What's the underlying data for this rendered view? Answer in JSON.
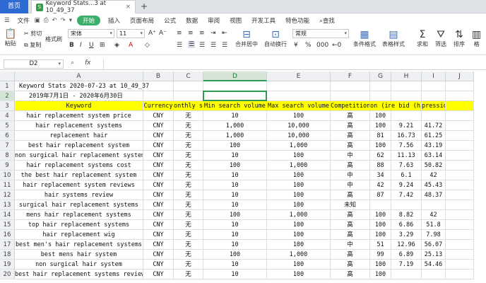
{
  "tabs": {
    "home": "首页",
    "doc": "Keyword Stats...3 at 10_49_37",
    "doc_close": "×",
    "add": "+",
    "file_icon": "S"
  },
  "menu": {
    "file": "文件",
    "items": [
      "开始",
      "插入",
      "页面布局",
      "公式",
      "数据",
      "审阅",
      "视图",
      "开发工具",
      "特色功能"
    ],
    "search": "查找"
  },
  "ribbon": {
    "paste": "粘贴",
    "cut": "剪切",
    "copy": "复制",
    "format_painter": "格式刷",
    "font_name": "宋体",
    "font_size": "11",
    "merge_center": "合并居中",
    "wrap": "自动换行",
    "number_format": "常规",
    "conditional": "条件格式",
    "table_style": "表格样式",
    "sum": "求和",
    "filter": "筛选",
    "sort": "排序",
    "more": "格"
  },
  "formula_bar": {
    "name_box": "D2",
    "fx": "fx",
    "value": ""
  },
  "grid": {
    "columns": [
      "A",
      "B",
      "C",
      "D",
      "E",
      "F",
      "G",
      "H",
      "I",
      "J"
    ],
    "selected_column": "D",
    "selected_row": "2",
    "row_numbers": [
      "1",
      "2",
      "3",
      "4",
      "5",
      "6",
      "7",
      "8",
      "9",
      "10",
      "11",
      "12",
      "13",
      "14",
      "15",
      "16",
      "17",
      "18",
      "19",
      "20"
    ],
    "rows": [
      [
        "Keyword Stats 2020-07-23 at 10_49_37",
        "",
        "",
        "",
        "",
        "",
        "",
        "",
        "",
        ""
      ],
      [
        "2019年7月1日 - 2020年6月30日",
        "",
        "",
        "",
        "",
        "",
        "",
        "",
        "",
        ""
      ],
      [
        "Keyword",
        "Currency",
        "onthly se",
        "Min search volume",
        "Max search volume",
        "Competition",
        "on (indexge bid (lo",
        "e bid (hi",
        "pression",
        ""
      ],
      [
        "hair replacement system price",
        "CNY",
        "无",
        "10",
        "100",
        "高",
        "100",
        "",
        "",
        ""
      ],
      [
        "hair replacement systems",
        "CNY",
        "无",
        "1,000",
        "10,000",
        "高",
        "100",
        "9.21",
        "41.72",
        ""
      ],
      [
        "replacement hair",
        "CNY",
        "无",
        "1,000",
        "10,000",
        "高",
        "81",
        "16.73",
        "61.25",
        ""
      ],
      [
        "best hair replacement system",
        "CNY",
        "无",
        "100",
        "1,000",
        "高",
        "100",
        "7.56",
        "43.19",
        ""
      ],
      [
        "non surgical hair replacement systems",
        "CNY",
        "无",
        "10",
        "100",
        "中",
        "62",
        "11.13",
        "63.14",
        ""
      ],
      [
        "hair replacement systems cost",
        "CNY",
        "无",
        "100",
        "1,000",
        "高",
        "88",
        "7.63",
        "50.82",
        ""
      ],
      [
        "the best hair replacement system",
        "CNY",
        "无",
        "10",
        "100",
        "中",
        "34",
        "6.1",
        "42",
        ""
      ],
      [
        "hair replacement system reviews",
        "CNY",
        "无",
        "10",
        "100",
        "中",
        "42",
        "9.24",
        "45.43",
        ""
      ],
      [
        "hair systems review",
        "CNY",
        "无",
        "10",
        "100",
        "高",
        "87",
        "7.42",
        "48.37",
        ""
      ],
      [
        "surgical hair replacement systems",
        "CNY",
        "无",
        "10",
        "100",
        "未知",
        "",
        "",
        "",
        ""
      ],
      [
        "mens hair replacement systems",
        "CNY",
        "无",
        "100",
        "1,000",
        "高",
        "100",
        "8.82",
        "42",
        ""
      ],
      [
        "top hair replacement systems",
        "CNY",
        "无",
        "10",
        "100",
        "高",
        "100",
        "6.86",
        "51.8",
        ""
      ],
      [
        "hair replacement wig",
        "CNY",
        "无",
        "10",
        "100",
        "高",
        "100",
        "3.29",
        "7.98",
        ""
      ],
      [
        "best men's hair replacement systems",
        "CNY",
        "无",
        "10",
        "100",
        "中",
        "51",
        "12.96",
        "56.07",
        ""
      ],
      [
        "best mens hair system",
        "CNY",
        "无",
        "100",
        "1,000",
        "高",
        "99",
        "6.89",
        "25.13",
        ""
      ],
      [
        "non surgical hair system",
        "CNY",
        "无",
        "10",
        "100",
        "高",
        "100",
        "7.19",
        "54.46",
        ""
      ],
      [
        "best hair replacement systems reviews",
        "CNY",
        "无",
        "10",
        "100",
        "高",
        "100",
        "",
        "",
        ""
      ]
    ]
  }
}
